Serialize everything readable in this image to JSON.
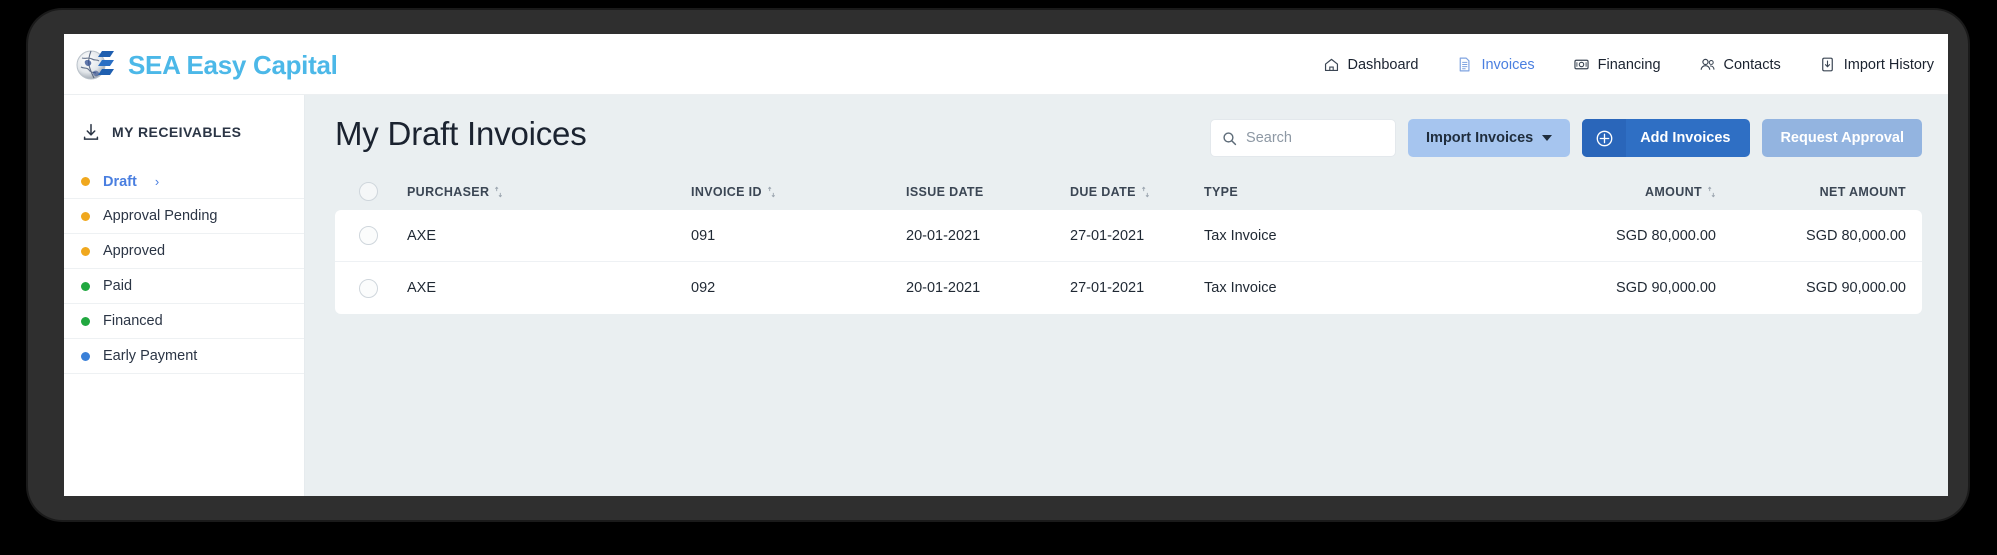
{
  "brand": {
    "name": "SEA Easy Capital",
    "logo_icon": "globe-bars-logo",
    "color": "#4cb8e8"
  },
  "nav": {
    "items": [
      {
        "label": "Dashboard",
        "icon": "home-icon",
        "active": false
      },
      {
        "label": "Invoices",
        "icon": "document-icon",
        "active": true
      },
      {
        "label": "Financing",
        "icon": "money-icon",
        "active": false
      },
      {
        "label": "Contacts",
        "icon": "people-icon",
        "active": false
      },
      {
        "label": "Import History",
        "icon": "import-icon",
        "active": false
      }
    ]
  },
  "sidebar": {
    "heading": "MY RECEIVABLES",
    "heading_icon": "download-icon",
    "items": [
      {
        "label": "Draft",
        "dot": "#f0a81e",
        "active": true,
        "chevron": "›"
      },
      {
        "label": "Approval Pending",
        "dot": "#f0a81e",
        "active": false
      },
      {
        "label": "Approved",
        "dot": "#f0a81e",
        "active": false
      },
      {
        "label": "Paid",
        "dot": "#21a840",
        "active": false
      },
      {
        "label": "Financed",
        "dot": "#21a840",
        "active": false
      },
      {
        "label": "Early Payment",
        "dot": "#3a80d8",
        "active": false
      }
    ]
  },
  "page": {
    "title": "My Draft Invoices"
  },
  "search": {
    "placeholder": "Search",
    "value": "",
    "icon": "search-icon"
  },
  "toolbar": {
    "import_label": "Import Invoices",
    "add_label": "Add Invoices",
    "add_icon": "plus-circle-icon",
    "request_label": "Request Approval"
  },
  "table": {
    "columns": [
      {
        "key": "checkbox",
        "label": "",
        "sortable": false
      },
      {
        "key": "purchaser",
        "label": "PURCHASER",
        "sortable": true
      },
      {
        "key": "invoice_id",
        "label": "INVOICE ID",
        "sortable": true
      },
      {
        "key": "issue_date",
        "label": "ISSUE DATE",
        "sortable": false
      },
      {
        "key": "due_date",
        "label": "DUE DATE",
        "sortable": true
      },
      {
        "key": "type",
        "label": "TYPE",
        "sortable": false
      },
      {
        "key": "amount",
        "label": "AMOUNT",
        "sortable": true
      },
      {
        "key": "net_amount",
        "label": "NET AMOUNT",
        "sortable": false
      }
    ],
    "rows": [
      {
        "purchaser": "AXE",
        "invoice_id": "091",
        "issue_date": "20-01-2021",
        "due_date": "27-01-2021",
        "type": "Tax Invoice",
        "amount": "SGD 80,000.00",
        "net_amount": "SGD 80,000.00"
      },
      {
        "purchaser": "AXE",
        "invoice_id": "092",
        "issue_date": "20-01-2021",
        "due_date": "27-01-2021",
        "type": "Tax Invoice",
        "amount": "SGD 90,000.00",
        "net_amount": "SGD 90,000.00"
      }
    ]
  }
}
